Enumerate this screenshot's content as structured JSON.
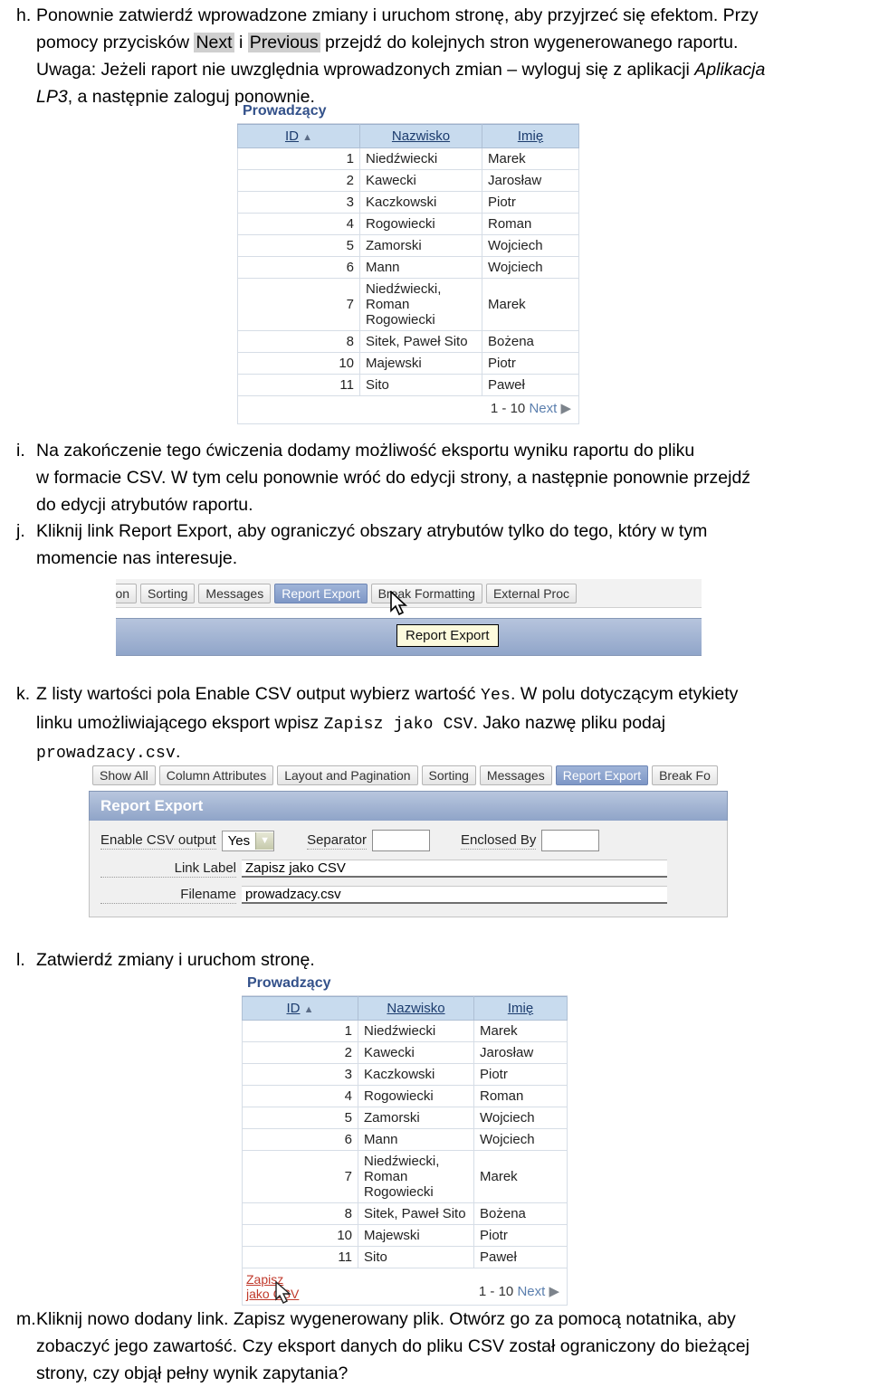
{
  "steps": [
    {
      "marker": "h.",
      "lines": [
        "Ponownie zatwierdź wprowadzone zmiany i uruchom stronę, aby przyjrzeć się efektom. Przy",
        "pomocy przycisków Next i Previous przejdź do kolejnych stron wygenerowanego raportu.",
        "Uwaga: Jeżeli raport nie uwzględnia wprowadzonych zmian – wyloguj się z aplikacji Aplikacja",
        "LP3, a następnie zaloguj ponownie."
      ],
      "highlight_next": "Next",
      "highlight_previous": "Previous",
      "italic_app": "Aplikacja",
      "italic_app2": "LP3"
    },
    {
      "marker": "i.",
      "lines": [
        "Na zakończenie tego ćwiczenia dodamy możliwość eksportu wyniku raportu do pliku",
        "w formacie CSV. W tym celu ponownie wróć do edycji strony, a następnie ponownie przejdź",
        "do edycji atrybutów raportu."
      ]
    },
    {
      "marker": "j.",
      "lines": [
        "Kliknij link Report Export, aby ograniczyć obszary atrybutów tylko do tego, który w tym",
        "momencie nas interesuje."
      ],
      "ui_term": "Report Export"
    },
    {
      "marker": "k.",
      "lines": [
        "Z listy wartości pola Enable CSV output wybierz wartość Yes. W polu dotyczącym etykiety",
        "linku umożliwiającego eksport wpisz Zapisz jako CSV. Jako nazwę pliku podaj",
        "prowadzacy.csv."
      ],
      "ui_term": "Enable CSV output",
      "mono_yes": "Yes",
      "mono_link_label": "Zapisz jako CSV",
      "mono_filename": "prowadzacy.csv"
    },
    {
      "marker": "l.",
      "lines": [
        "Zatwierdź zmiany i uruchom stronę."
      ]
    },
    {
      "marker": "m.",
      "lines": [
        "Kliknij nowo dodany link. Zapisz wygenerowany plik. Otwórz go za pomocą notatnika, aby",
        "zobaczyć jego zawartość. Czy eksport danych do pliku CSV został ograniczony do bieżącej",
        "strony, czy objął pełny wynik zapytania?"
      ]
    }
  ],
  "report": {
    "title": "Prowadzący",
    "columns": [
      "ID",
      "Nazwisko",
      "Imię"
    ],
    "sort_indicator": "▲",
    "rows": [
      [
        "1",
        "Niedźwiecki",
        "Marek"
      ],
      [
        "2",
        "Kawecki",
        "Jarosław"
      ],
      [
        "3",
        "Kaczkowski",
        "Piotr"
      ],
      [
        "4",
        "Rogowiecki",
        "Roman"
      ],
      [
        "5",
        "Zamorski",
        "Wojciech"
      ],
      [
        "6",
        "Mann",
        "Wojciech"
      ],
      [
        "7",
        "Niedźwiecki, Roman Rogowiecki",
        "Marek"
      ],
      [
        "8",
        "Sitek, Paweł Sito",
        "Bożena"
      ],
      [
        "10",
        "Majewski",
        "Piotr"
      ],
      [
        "11",
        "Sito",
        "Paweł"
      ]
    ],
    "pager_range": "1 - 10",
    "pager_next": "Next",
    "pager_arrow": "▶",
    "csv_link_line1": "Zapisz",
    "csv_link_line2": "jako CSV"
  },
  "tabbar_j": {
    "tabs": [
      {
        "label": "gination",
        "active": false
      },
      {
        "label": "Sorting",
        "active": false
      },
      {
        "label": "Messages",
        "active": false
      },
      {
        "label": "Report Export",
        "active": true
      },
      {
        "label": "Break Formatting",
        "active": false
      },
      {
        "label": "External Proc",
        "active": false
      }
    ],
    "tooltip": "Report Export"
  },
  "tabbar_k": {
    "tabs": [
      {
        "label": "Show All",
        "active": false
      },
      {
        "label": "Column Attributes",
        "active": false
      },
      {
        "label": "Layout and Pagination",
        "active": false
      },
      {
        "label": "Sorting",
        "active": false
      },
      {
        "label": "Messages",
        "active": false
      },
      {
        "label": "Report Export",
        "active": true
      },
      {
        "label": "Break Fo",
        "active": false
      }
    ]
  },
  "export_panel": {
    "heading": "Report Export",
    "enable_label": "Enable CSV output",
    "enable_value": "Yes",
    "separator_label": "Separator",
    "separator_value": "",
    "enclosed_label": "Enclosed By",
    "enclosed_value": "",
    "link_label_label": "Link Label",
    "link_label_value": "Zapisz jako CSV",
    "filename_label": "Filename",
    "filename_value": "prowadzacy.csv"
  },
  "colors": {
    "report_title": "#33518a",
    "table_header_bg": "#c8dbee",
    "table_header_text": "#1c3c6e",
    "csv_link": "#c0392b",
    "active_tab_bg": "#7e97c6",
    "panel_header_bg": "#8fa4c8",
    "tooltip_bg": "#fdfbdd",
    "highlight_bg": "#cfcfcf"
  }
}
